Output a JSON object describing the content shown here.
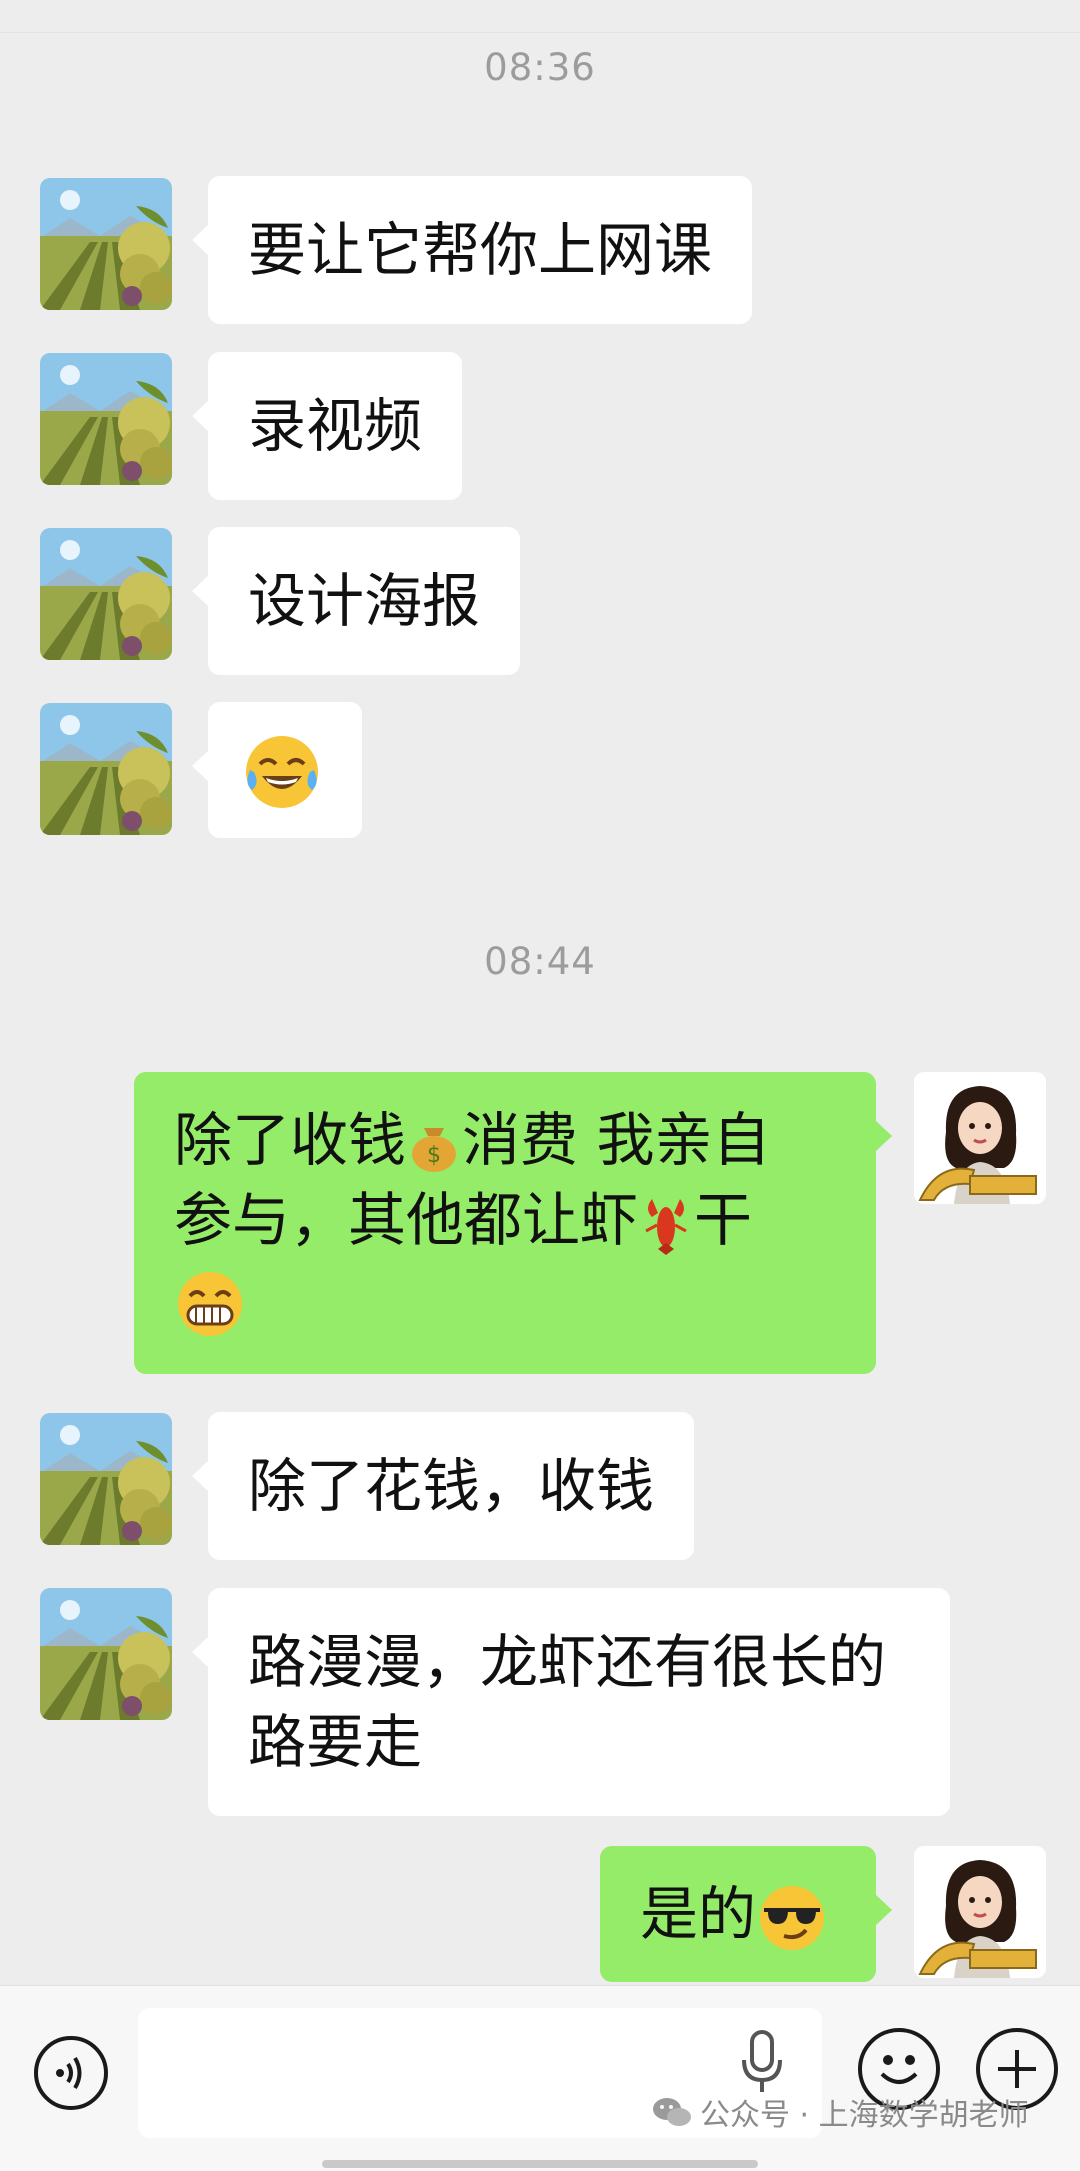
{
  "chat": {
    "timestamps": [
      "08:36",
      "08:44"
    ],
    "messages": [
      {
        "side": "in",
        "text": "要让它帮你上网课"
      },
      {
        "side": "in",
        "text": "录视频"
      },
      {
        "side": "in",
        "text": "设计海报"
      },
      {
        "side": "in",
        "icon": "tears-of-joy-emoji"
      },
      {
        "side": "out",
        "lines": [
          "除了收钱",
          "消费 我亲自",
          "参与，其他都让虾",
          "干"
        ],
        "icons": [
          "money-bag-emoji",
          "lobster-emoji",
          "grinning-emoji"
        ]
      },
      {
        "side": "in",
        "text": "除了花钱，收钱"
      },
      {
        "side": "in",
        "lines": [
          "路漫漫，龙虾还有很长的",
          "路要走"
        ]
      },
      {
        "side": "out",
        "text": "是的",
        "icon": "sunglasses-emoji"
      }
    ]
  },
  "inputbar": {
    "voice_icon": "voice-icon",
    "mic_icon": "mic-icon",
    "emoji_icon": "emoji-icon",
    "plus_icon": "plus-icon",
    "input_value": ""
  },
  "watermark": {
    "text": "公众号 · 上海数学胡老师",
    "icon": "wechat-icon"
  },
  "colors": {
    "background": "#ededed",
    "incoming_bubble": "#ffffff",
    "outgoing_bubble": "#95ec69",
    "timestamp": "#9c9c9c"
  }
}
